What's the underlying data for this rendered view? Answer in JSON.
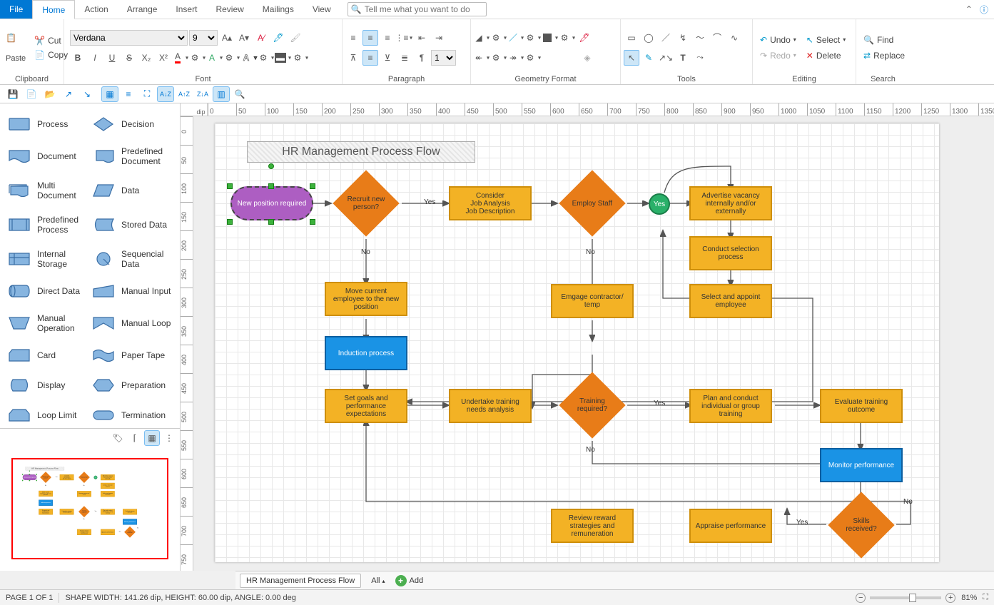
{
  "menu": {
    "file": "File",
    "home": "Home",
    "action": "Action",
    "arrange": "Arrange",
    "insert": "Insert",
    "review": "Review",
    "mailings": "Mailings",
    "view": "View",
    "search_placeholder": "Tell me what you want to do"
  },
  "ribbon": {
    "clipboard": {
      "title": "Clipboard",
      "paste": "Paste",
      "cut": "Cut",
      "copy": "Copy"
    },
    "font": {
      "title": "Font",
      "family": "Verdana",
      "size": "9"
    },
    "paragraph": {
      "title": "Paragraph",
      "indent": "1"
    },
    "geometry": {
      "title": "Geometry Format"
    },
    "tools": {
      "title": "Tools"
    },
    "editing": {
      "title": "Editing",
      "undo": "Undo",
      "redo": "Redo",
      "select": "Select",
      "delete": "Delete"
    },
    "search": {
      "title": "Search",
      "find": "Find",
      "replace": "Replace"
    }
  },
  "ruler_unit": "dip",
  "ruler_h": [
    "0",
    "50",
    "100",
    "150",
    "200",
    "250",
    "300",
    "350",
    "400",
    "450",
    "500",
    "550",
    "600",
    "650",
    "700",
    "750",
    "800",
    "850",
    "900",
    "950",
    "1000",
    "1050",
    "1100",
    "1150",
    "1200",
    "1250",
    "1300",
    "1350",
    "13"
  ],
  "ruler_v": [
    "0",
    "50",
    "100",
    "150",
    "200",
    "250",
    "300",
    "350",
    "400",
    "450",
    "500",
    "550",
    "600",
    "650",
    "700",
    "750"
  ],
  "palette": [
    {
      "label": "Process"
    },
    {
      "label": "Decision"
    },
    {
      "label": "Document"
    },
    {
      "label": "Predefined Document"
    },
    {
      "label": "Multi Document"
    },
    {
      "label": "Data"
    },
    {
      "label": "Predefined Process"
    },
    {
      "label": "Stored Data"
    },
    {
      "label": "Internal Storage"
    },
    {
      "label": "Sequencial Data"
    },
    {
      "label": "Direct Data"
    },
    {
      "label": "Manual Input"
    },
    {
      "label": "Manual Operation"
    },
    {
      "label": "Manual Loop"
    },
    {
      "label": "Card"
    },
    {
      "label": "Paper Tape"
    },
    {
      "label": "Display"
    },
    {
      "label": "Preparation"
    },
    {
      "label": "Loop Limit"
    },
    {
      "label": "Termination"
    }
  ],
  "diagram": {
    "title": "HR Management Process Flow",
    "shapes": {
      "start": "New position required",
      "recruit": "Recruit new person?",
      "consider": "Consider\nJob Analysis\nJob Description",
      "employ": "Employ Staff",
      "yescirc": "Yes",
      "advertise": "Advertise vacancy internally and/or externally",
      "conduct": "Conduct selection process",
      "select": "Select and appoint employee",
      "move": "Move current employee to the new position",
      "contractor": "Emgage contractor/ temp",
      "induction": "Induction process",
      "goals": "Set goals and performance expectations",
      "undertake": "Undertake training needs analysis",
      "trainreq": "Training required?",
      "plan": "Plan and conduct individual or group training",
      "evaluate": "Evaluate training outcome",
      "monitor": "Monitor performance",
      "skills": "Skills received?",
      "appraise": "Appraise performance",
      "review": "Review reward strategies and remuneration"
    },
    "labels": {
      "yes": "Yes",
      "no": "No"
    }
  },
  "pagetabs": {
    "active": "HR Management Process Flow",
    "all": "All",
    "add": "Add"
  },
  "status": {
    "page": "PAGE 1 OF 1",
    "shape": "SHAPE WIDTH: 141.26 dip, HEIGHT: 60.00 dip, ANGLE: 0.00 deg",
    "zoom": "81%"
  }
}
